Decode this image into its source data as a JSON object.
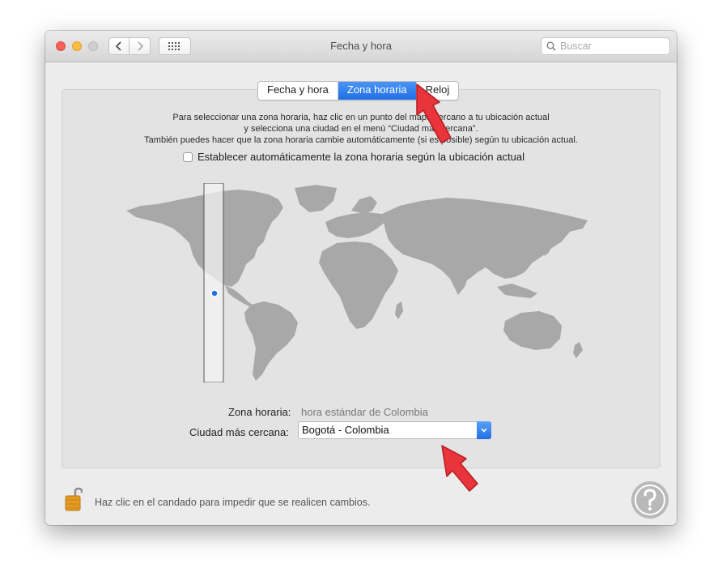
{
  "window": {
    "title": "Fecha y hora",
    "search_placeholder": "Buscar"
  },
  "tabs": [
    {
      "label": "Fecha y hora",
      "active": false
    },
    {
      "label": "Zona horaria",
      "active": true
    },
    {
      "label": "Reloj",
      "active": false
    }
  ],
  "description": {
    "line1": "Para seleccionar una zona horaria, haz clic en un punto del mapa cercano a tu ubicación actual",
    "line2": "y selecciona una ciudad en el menú “Ciudad más cercana”.",
    "line3": "También puedes hacer que la zona horaria cambie automáticamente (si es posible) según tu ubicación actual."
  },
  "auto_timezone": {
    "label": "Establecer automáticamente la zona horaria según la ubicación actual",
    "checked": false
  },
  "timezone": {
    "label": "Zona horaria:",
    "value": "hora estándar de Colombia"
  },
  "closest_city": {
    "label": "Ciudad más cercana:",
    "value": "Bogotá - Colombia"
  },
  "lock": {
    "text": "Haz clic en el candado para impedir que se realicen cambios.",
    "state": "unlocked"
  },
  "colors": {
    "accent": "#1f6fe5",
    "annotation_arrow": "#e8343a",
    "map_land": "#a8a8a8",
    "map_highlight": "#f2f2f2"
  }
}
